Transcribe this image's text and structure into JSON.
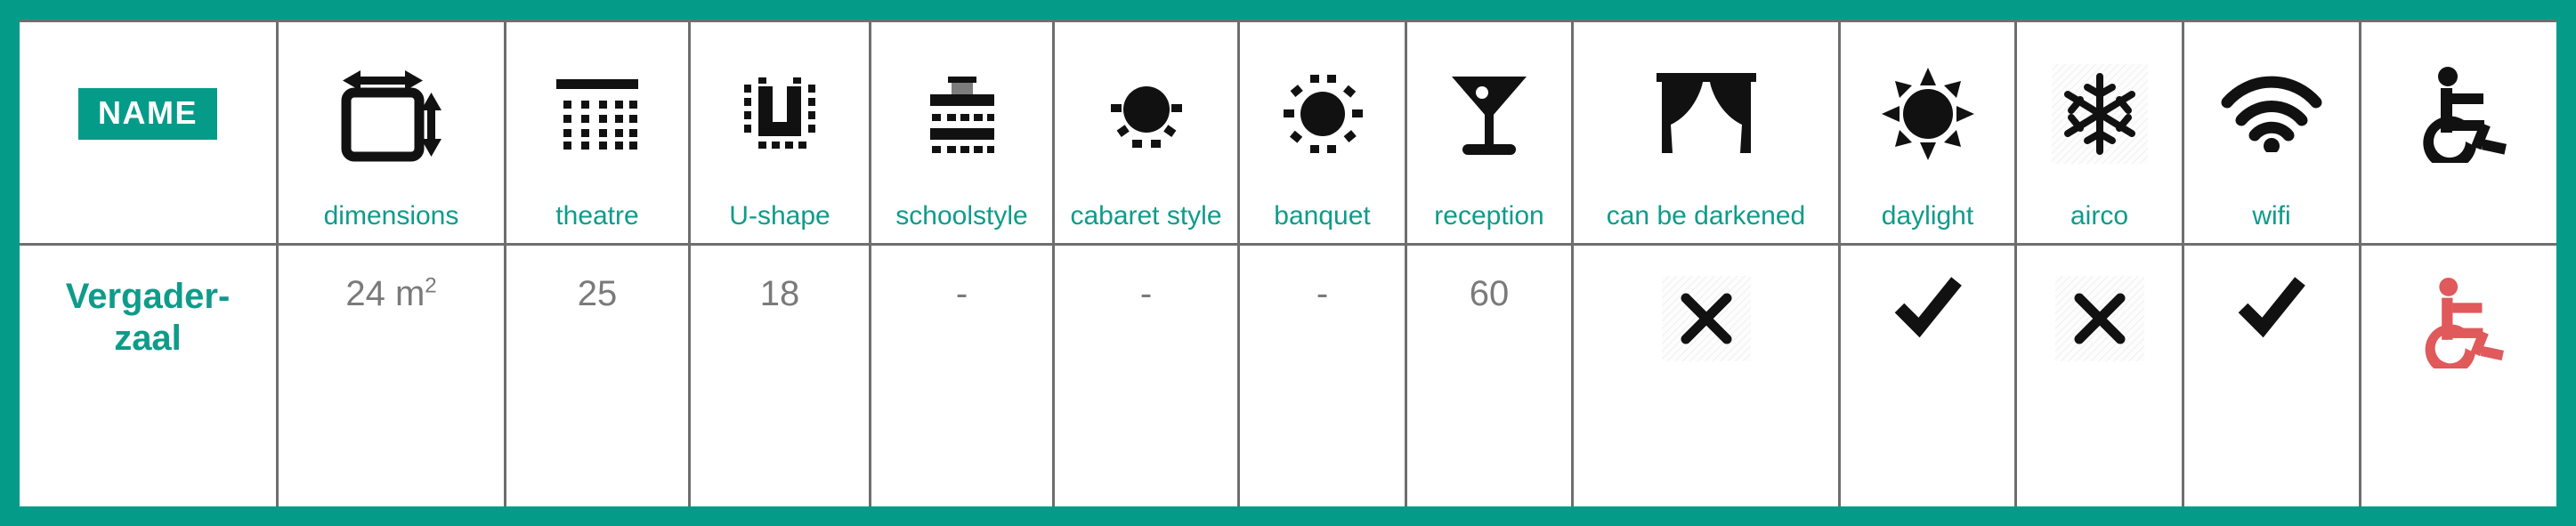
{
  "theme": {
    "frame_color": "#059b89",
    "accent_teal": "#0f9b8a",
    "grid_gray": "#6e6e6e",
    "value_gray": "#7a7a7a",
    "icon_black": "#111111",
    "wheelchair_red": "#e0595b"
  },
  "header": {
    "name_badge": "NAME",
    "columns": [
      {
        "icon": "name-badge",
        "label": ""
      },
      {
        "icon": "dimensions-icon",
        "label": "dimensions"
      },
      {
        "icon": "theatre-icon",
        "label": "theatre"
      },
      {
        "icon": "u-shape-icon",
        "label": "U-shape"
      },
      {
        "icon": "schoolstyle-icon",
        "label": "schoolstyle"
      },
      {
        "icon": "cabaret-style-icon",
        "label": "cabaret style"
      },
      {
        "icon": "banquet-icon",
        "label": "banquet"
      },
      {
        "icon": "reception-icon",
        "label": "reception"
      },
      {
        "icon": "curtain-icon",
        "label": "can be darkened"
      },
      {
        "icon": "sun-icon",
        "label": "daylight"
      },
      {
        "icon": "snowflake-icon",
        "label": "airco"
      },
      {
        "icon": "wifi-icon",
        "label": "wifi"
      },
      {
        "icon": "wheelchair-icon",
        "label": ""
      }
    ]
  },
  "rows": [
    {
      "name": "Vergader-zaal",
      "name_line1": "Vergader-",
      "name_line2": "zaal",
      "dimensions": "24 m",
      "dimensions_unit": "2",
      "theatre": "25",
      "u_shape": "18",
      "schoolstyle": "-",
      "cabaret_style": "-",
      "banquet": "-",
      "reception": "60",
      "can_be_darkened": "cross",
      "daylight": "check",
      "airco": "cross",
      "wifi": "check",
      "wheelchair": "wheelchair-icon-red"
    }
  ]
}
